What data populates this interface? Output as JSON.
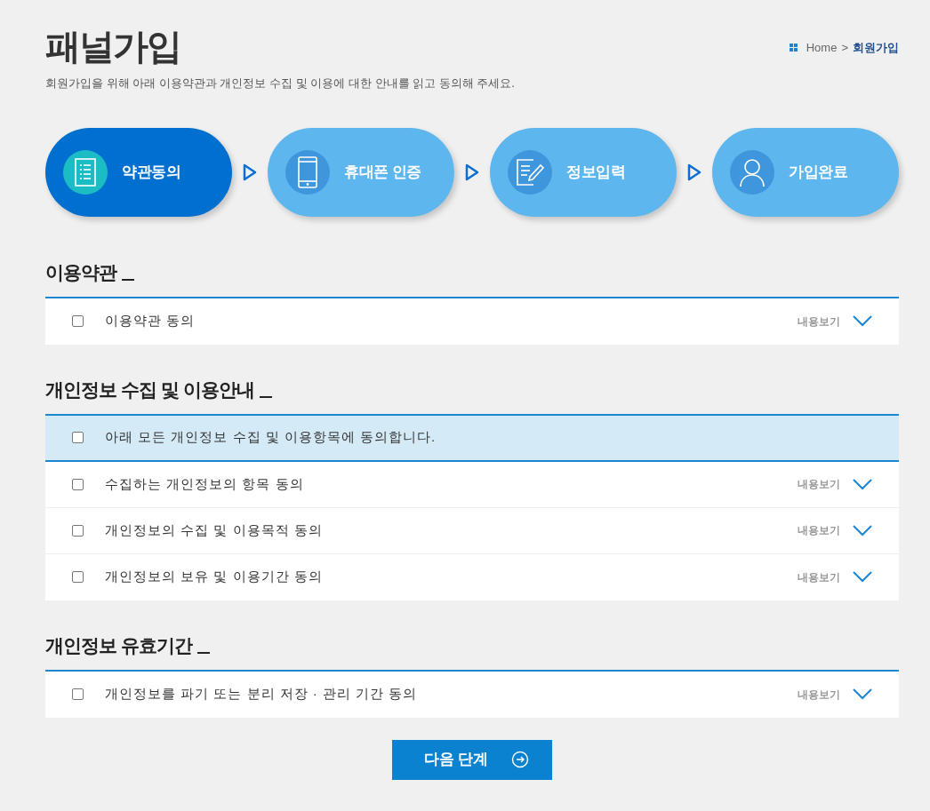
{
  "page_title": "패널가입",
  "breadcrumb": {
    "home": "Home",
    "separator": ">",
    "current": "회원가입"
  },
  "intro": "회원가입을 위해 아래 이용약관과 개인정보 수집 및 이용에 대한 안내를 읽고 동의해 주세요.",
  "steps": [
    {
      "label": "약관동의",
      "kind": "list",
      "selected": true
    },
    {
      "label": "휴대폰 인증",
      "kind": "phone",
      "selected": false
    },
    {
      "label": "정보입력",
      "kind": "form",
      "selected": false
    },
    {
      "label": "가입완료",
      "kind": "person",
      "selected": false
    }
  ],
  "sections": [
    {
      "title": "이용약관",
      "rows": [
        {
          "kind": "item",
          "label": "이용약관 동의",
          "checked": false,
          "view": "내용보기"
        }
      ]
    },
    {
      "title": "개인정보 수집 및 이용안내",
      "rows": [
        {
          "kind": "all",
          "label": "아래 모든 개인정보 수집 및 이용항목에 동의합니다.",
          "checked": false
        },
        {
          "kind": "item",
          "label": "수집하는 개인정보의 항목 동의",
          "checked": false,
          "view": "내용보기"
        },
        {
          "kind": "item",
          "label": "개인정보의 수집 및 이용목적 동의",
          "checked": false,
          "view": "내용보기"
        },
        {
          "kind": "item",
          "label": "개인정보의 보유 및 이용기간 동의",
          "checked": false,
          "view": "내용보기"
        }
      ]
    },
    {
      "title": "개인정보 유효기간",
      "rows": [
        {
          "kind": "item",
          "label": "개인정보를 파기 또는 분리 저장 · 관리 기간 동의",
          "checked": false,
          "view": "내용보기"
        }
      ]
    }
  ],
  "next_button": "다음 단계"
}
